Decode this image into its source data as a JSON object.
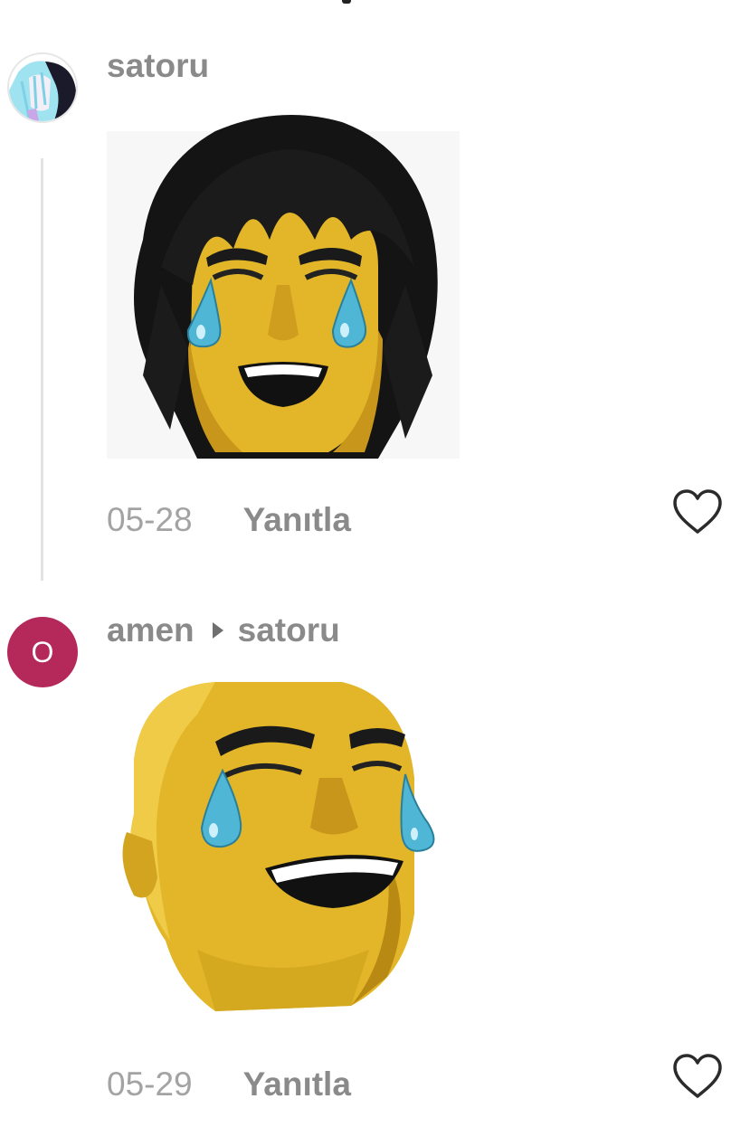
{
  "comments": [
    {
      "username": "satoru",
      "reply_to": "",
      "date": "05-28",
      "reply_label": "Yanıtla",
      "avatar_letter": "",
      "sticker": "crying-laughing-yellow-face-long-hair"
    },
    {
      "username": "amen",
      "reply_to": "satoru",
      "date": "05-29",
      "reply_label": "Yanıtla",
      "avatar_letter": "O",
      "sticker": "crying-laughing-yellow-face-bald"
    }
  ],
  "colors": {
    "avatar_bg": "#b5285a",
    "text_muted": "#8a8a8a",
    "date_text": "#a3a3a3",
    "sticker_yellow": "#e2b628",
    "tear_blue": "#4fb6d6"
  }
}
